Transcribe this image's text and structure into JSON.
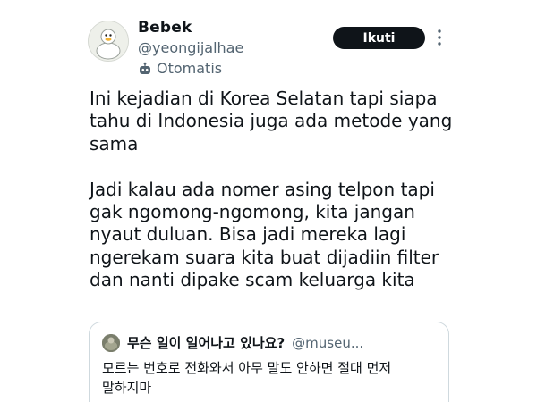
{
  "author": {
    "display_name": "Bebek",
    "handle": "@yeongijalhae",
    "automated_label": "Otomatis",
    "avatar_icon": "duck-avatar"
  },
  "actions": {
    "follow_label": "Ikuti",
    "more_icon": "more-vertical-icon"
  },
  "tweet": {
    "paragraphs": [
      "Ini kejadian di Korea Selatan tapi siapa\ntahu di Indonesia juga ada metode yang\nsama",
      "Jadi kalau ada nomer asing telpon tapi\ngak ngomong-ngomong, kita jangan\nnyaut duluan. Bisa jadi mereka lagi\nngerekam suara kita buat dijadiin filter\ndan nanti dipake scam keluarga kita"
    ]
  },
  "quote": {
    "display_name": "무슨 일이 일어나고 있나요?",
    "handle": "@museu...",
    "text": "모르는 번호로 전화와서 아무 말도 안하면 절대 먼저\n말하지마"
  },
  "colors": {
    "text": "#0f1419",
    "secondary": "#536471",
    "border": "#cfd9de",
    "button_bg": "#0f1419",
    "button_text": "#ffffff"
  }
}
